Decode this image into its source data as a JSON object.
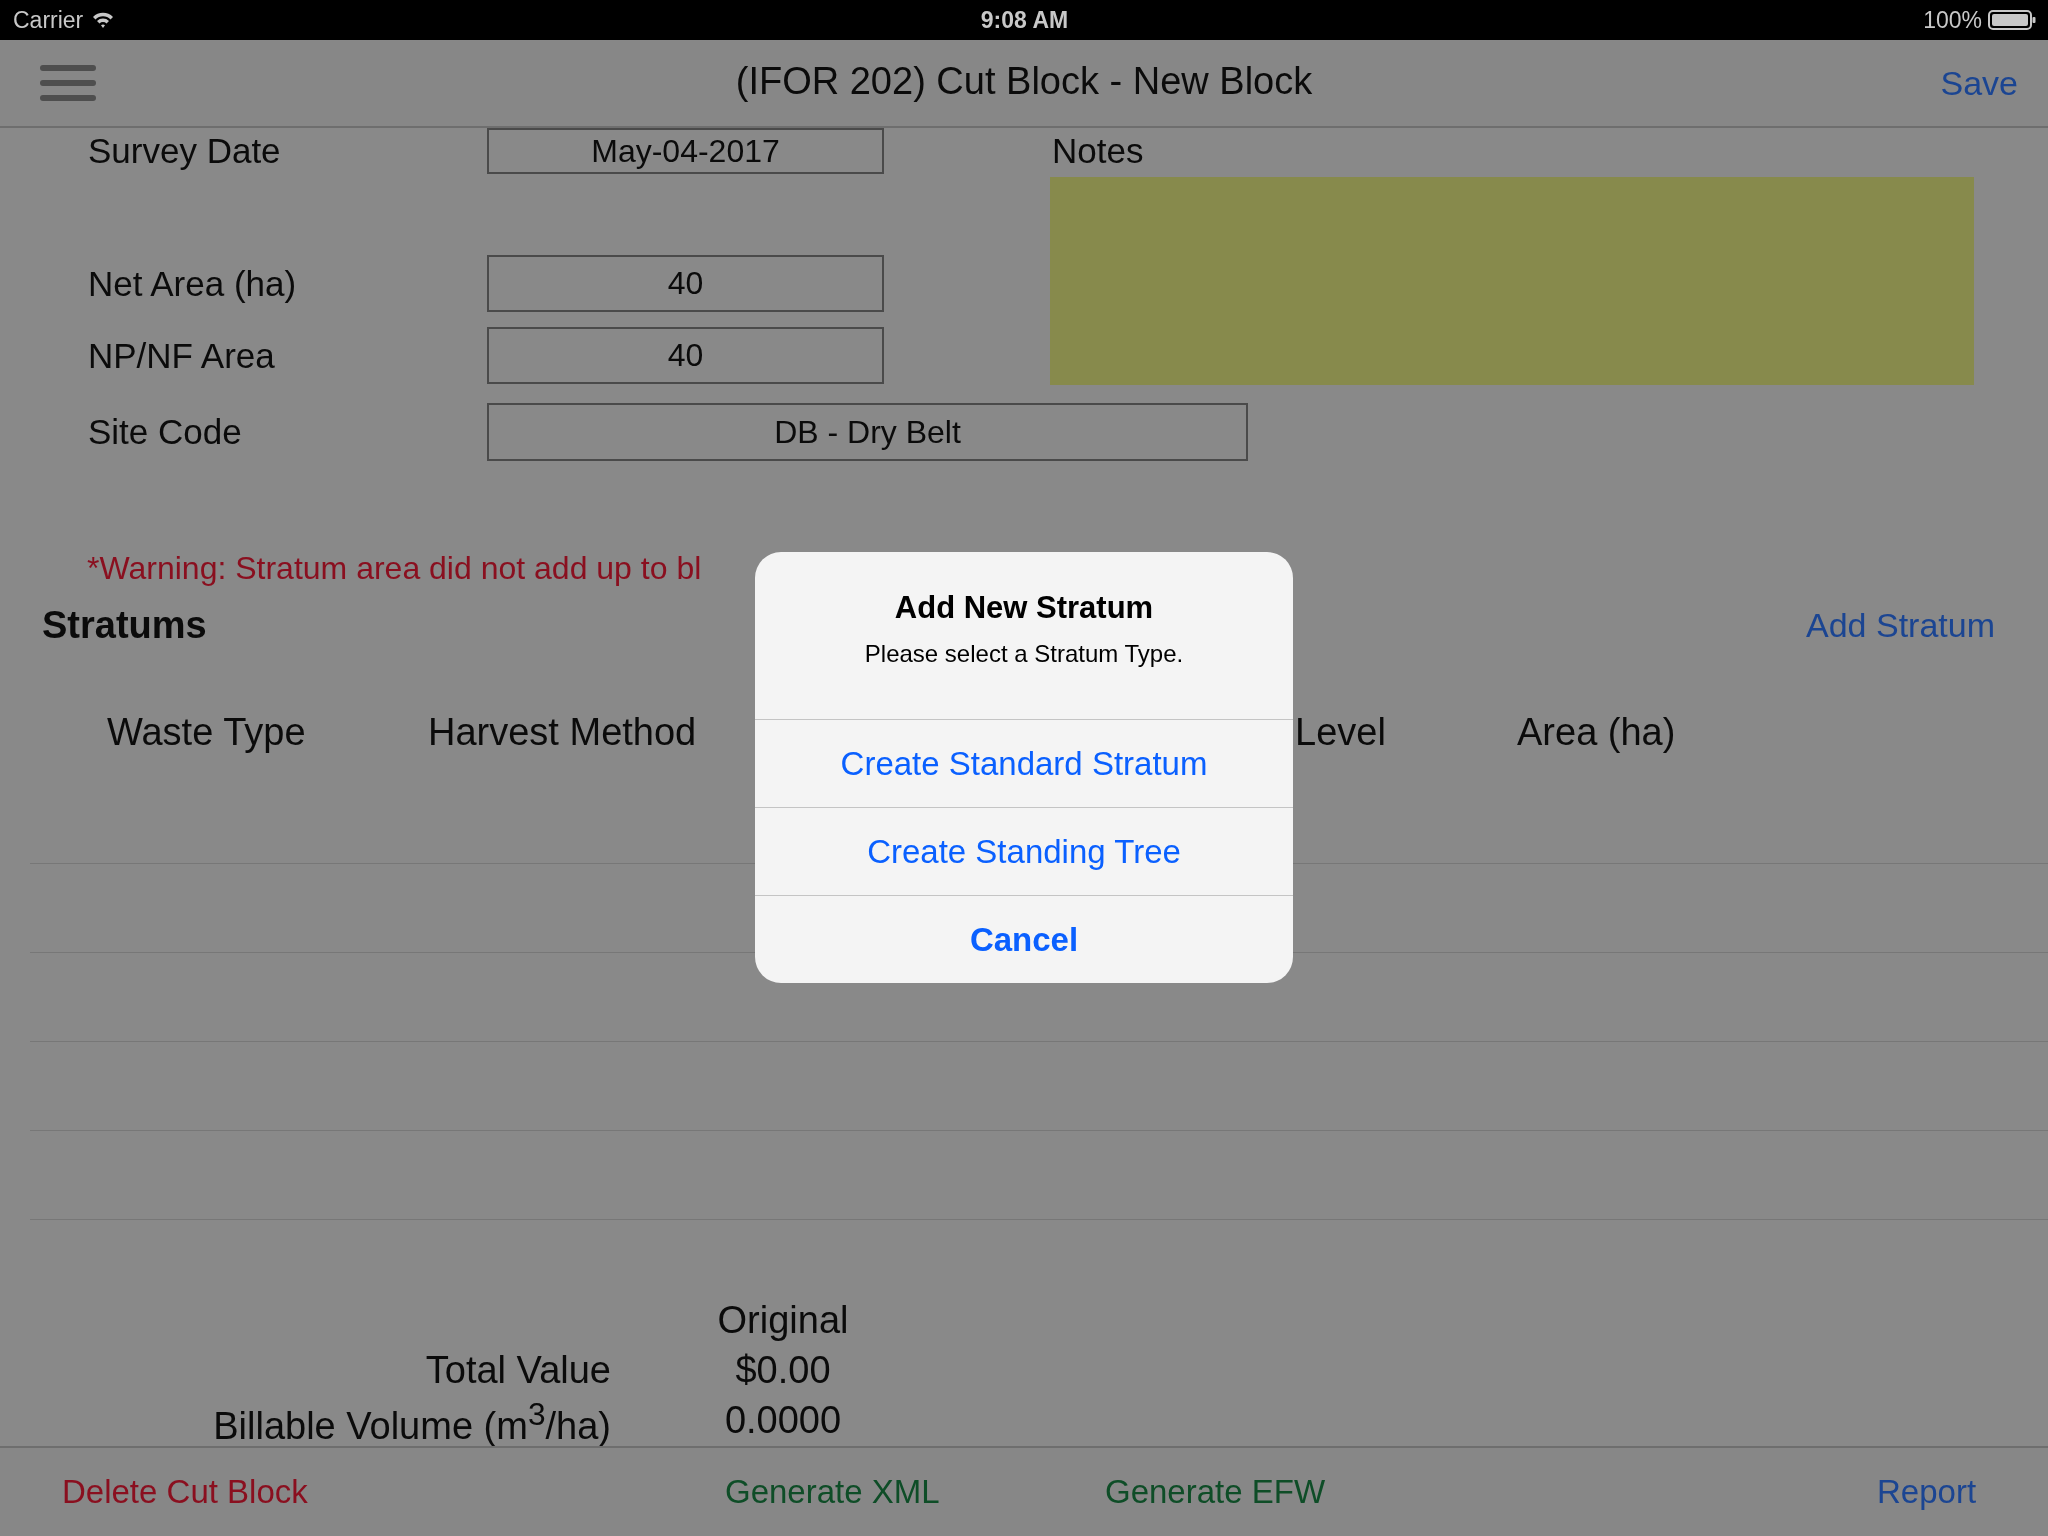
{
  "status_bar": {
    "carrier": "Carrier",
    "time": "9:08 AM",
    "battery": "100%"
  },
  "nav_bar": {
    "title": "(IFOR 202) Cut Block - New Block",
    "save": "Save"
  },
  "form": {
    "fields": [
      {
        "label": "Survey Date",
        "value": "May-04-2017",
        "kind": "narrow"
      },
      {
        "label": "Net Area (ha)",
        "value": "40",
        "kind": "narrow"
      },
      {
        "label": "NP/NF Area",
        "value": "40",
        "kind": "narrow"
      },
      {
        "label": "Site Code",
        "value": "DB - Dry Belt",
        "kind": "wide"
      }
    ],
    "notes": {
      "label": "Notes"
    }
  },
  "warning": "*Warning: Stratum area did not add up to bl",
  "stratums": {
    "title": "Stratums",
    "add": "Add Stratum",
    "columns": [
      "Waste Type",
      "Harvest Method",
      "Level",
      "Area (ha)"
    ]
  },
  "summary": {
    "column": "Original",
    "rows": [
      {
        "label": "Total Value",
        "value": "$0.00"
      },
      {
        "label": "Billable Volume (m$^{3}$/ha)",
        "value": "0.0000"
      }
    ]
  },
  "toolbar": [
    {
      "label": "Delete Cut Block",
      "kind": "destructive"
    },
    {
      "label": "Generate XML",
      "kind": "export"
    },
    {
      "label": "Generate EFW",
      "kind": "export"
    },
    {
      "label": "Report",
      "kind": "link"
    }
  ],
  "dialog": {
    "title": "Add New Stratum",
    "message": "Please select a Stratum Type.",
    "actions": [
      {
        "label": "Create Standard Stratum",
        "kind": "default"
      },
      {
        "label": "Create Standing Tree",
        "kind": "default"
      },
      {
        "label": "Cancel",
        "kind": "cancel"
      }
    ]
  }
}
